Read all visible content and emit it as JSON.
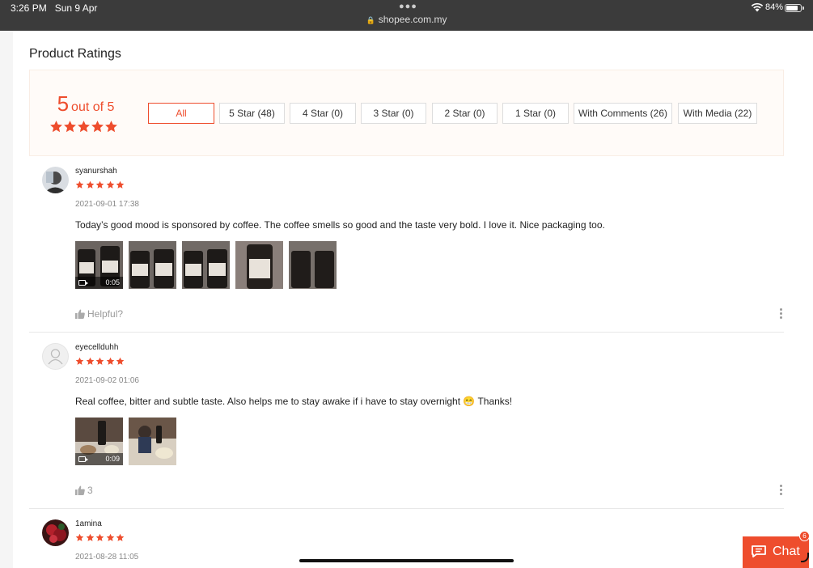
{
  "status_bar": {
    "time": "3:26 PM",
    "date": "Sun 9 Apr",
    "url": "shopee.com.my",
    "battery": "84%",
    "battery_level": 0.84,
    "icons": [
      "wifi-icon",
      "battery-icon",
      "lock-icon"
    ]
  },
  "ratings": {
    "title": "Product Ratings",
    "score": "5",
    "score_suffix": "out of 5",
    "stars": 5,
    "filters": [
      {
        "label": "All",
        "active": true
      },
      {
        "label": "5 Star (48)",
        "active": false
      },
      {
        "label": "4 Star (0)",
        "active": false
      },
      {
        "label": "3 Star (0)",
        "active": false
      },
      {
        "label": "2 Star (0)",
        "active": false
      },
      {
        "label": "1 Star (0)",
        "active": false
      },
      {
        "label": "With Comments (26)",
        "active": false
      },
      {
        "label": "With Media (22)",
        "active": false
      }
    ]
  },
  "reviews": [
    {
      "username": "syanurshah",
      "stars": 5,
      "date": "2021-09-01 17:38",
      "text": "Today’s good mood is sponsored by coffee. The coffee smells so good and the taste very bold. I love it. Nice packaging too.",
      "media_count": 5,
      "video_duration": "0:05",
      "helpful": "Helpful?"
    },
    {
      "username": "eyecellduhh",
      "stars": 5,
      "date": "2021-09-02 01:06",
      "text": "Real coffee, bitter and subtle taste. Also helps me to stay awake if i have to stay overnight 😁 Thanks!",
      "media_count": 2,
      "video_duration": "0:09",
      "helpful": "3"
    },
    {
      "username": "1amina",
      "stars": 5,
      "date": "2021-08-28 11:05"
    }
  ],
  "chat": {
    "label": "Chat",
    "badge": "6"
  },
  "colors": {
    "accent": "#ee4d2d",
    "status_bar": "#3b3b3b"
  }
}
